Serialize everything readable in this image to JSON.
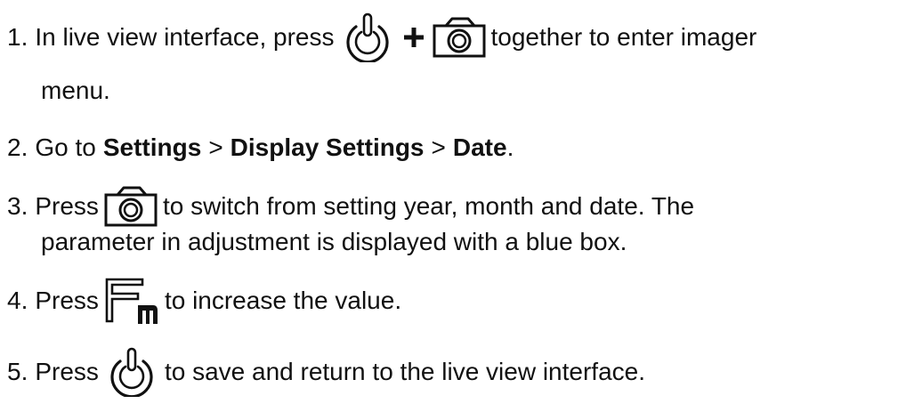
{
  "steps": [
    {
      "number": "1.",
      "text_before": "In live view interface, press",
      "text_after": "together to enter imager",
      "continuation": "menu.",
      "icons": [
        "power-button-icon",
        "plus-icon",
        "camera-button-icon"
      ]
    },
    {
      "number": "2.",
      "prefix": "Go to",
      "path": [
        "Settings",
        "Display Settings",
        "Date"
      ],
      "separator": ">",
      "suffix": "."
    },
    {
      "number": "3.",
      "text_before": "Press",
      "text_after": "to switch from setting year, month and date. The",
      "continuation": "parameter in adjustment is displayed with a blue box.",
      "icons": [
        "camera-button-icon"
      ]
    },
    {
      "number": "4.",
      "text_before": "Press",
      "text_after": "to increase the value.",
      "icons": [
        "fn-button-icon"
      ]
    },
    {
      "number": "5.",
      "text_before": "Press",
      "text_after": "to save and return to the live view interface.",
      "icons": [
        "power-button-icon"
      ]
    }
  ]
}
